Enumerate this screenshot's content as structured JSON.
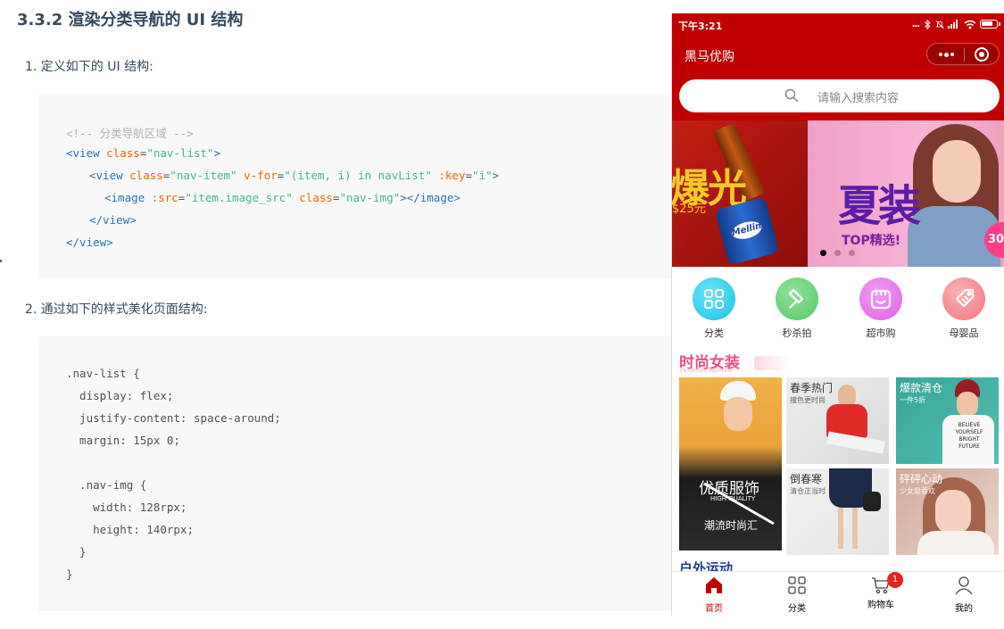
{
  "doc": {
    "title": "3.3.2 渲染分类导航的 UI 结构",
    "step1": "1. 定义如下的 UI 结构:",
    "step2": "2. 通过如下的样式美化页面结构:",
    "html_code": {
      "comment": "<!-- 分类导航区域 -->",
      "line2": {
        "open": "<view ",
        "attr": "class",
        "eq": "=",
        "val": "\"nav-list\"",
        "close": ">"
      },
      "line3": {
        "open": "<view ",
        "attr1": "class",
        "eq1": "=",
        "val1": "\"nav-item\"",
        "attr2": " v-for",
        "eq2": "=",
        "val2": "\"(item, i) in navList\"",
        "attr3": " :key",
        "eq3": "=",
        "val3": "\"i\"",
        "close": ">"
      },
      "line4": {
        "open": "<image ",
        "attr1": ":src",
        "eq1": "=",
        "val1": "\"item.image_src\"",
        "attr2": " class",
        "eq2": "=",
        "val2": "\"nav-img\"",
        "close": "></image>"
      },
      "line5": "</view>",
      "line6": "</view>"
    },
    "css_code": [
      ".nav-list {",
      "  display: flex;",
      "  justify-content: space-around;",
      "  margin: 15px 0;",
      "",
      "  .nav-img {",
      "    width: 128rpx;",
      "    height: 140rpx;",
      "  }",
      "}"
    ]
  },
  "phone": {
    "status": {
      "time": "下午3:21",
      "dots": "..."
    },
    "nav_title": "黑马优购",
    "search_placeholder": "请输入搜索内容",
    "swiper": {
      "slide1_big_text": "爆光",
      "slide1_price": "$25元",
      "slide1_can_label": "Mellin",
      "slide2_big_text": "夏装",
      "slide2_sub_text": "TOP精选!",
      "slide2_badge": "30",
      "active_index": 0,
      "count": 3
    },
    "nav_items": [
      {
        "label": "分类",
        "color": "#19c3e8",
        "icon": "grid-icon"
      },
      {
        "label": "秒杀拍",
        "color": "#55c966",
        "icon": "hammer-icon"
      },
      {
        "label": "超市购",
        "color": "#e15ee8",
        "icon": "basket-icon"
      },
      {
        "label": "母婴品",
        "color": "#f5767e",
        "icon": "tag-icon"
      }
    ],
    "floor": {
      "title": "时尚女装",
      "subtitle": "FASHION WOMEN",
      "big_tile": {
        "title": "优质服饰",
        "sub": "HIGH QUALITY",
        "caption": "潮流时尚汇"
      },
      "tiles": [
        {
          "title": "春季热门",
          "sub": "撞色更时尚",
          "title_color": "#333333"
        },
        {
          "title": "爆款清仓",
          "sub": "一件5折",
          "title_color": "#ffffff"
        },
        {
          "title": "倒春寒",
          "sub": "清仓正当时",
          "title_color": "#333333"
        },
        {
          "title": "砰砰心动",
          "sub": "少女最喜欢",
          "title_color": "#ffffff"
        }
      ]
    },
    "floor2_title": "户外运动",
    "tabbar": [
      {
        "label": "首页",
        "icon": "home-icon",
        "active": true
      },
      {
        "label": "分类",
        "icon": "category-icon",
        "active": false
      },
      {
        "label": "购物车",
        "icon": "cart-icon",
        "active": false,
        "badge": "1"
      },
      {
        "label": "我的",
        "icon": "user-icon",
        "active": false
      }
    ],
    "colors": {
      "brand": "#c00000",
      "floor_title": "#f04e8a",
      "badge": "#e8221e"
    }
  }
}
